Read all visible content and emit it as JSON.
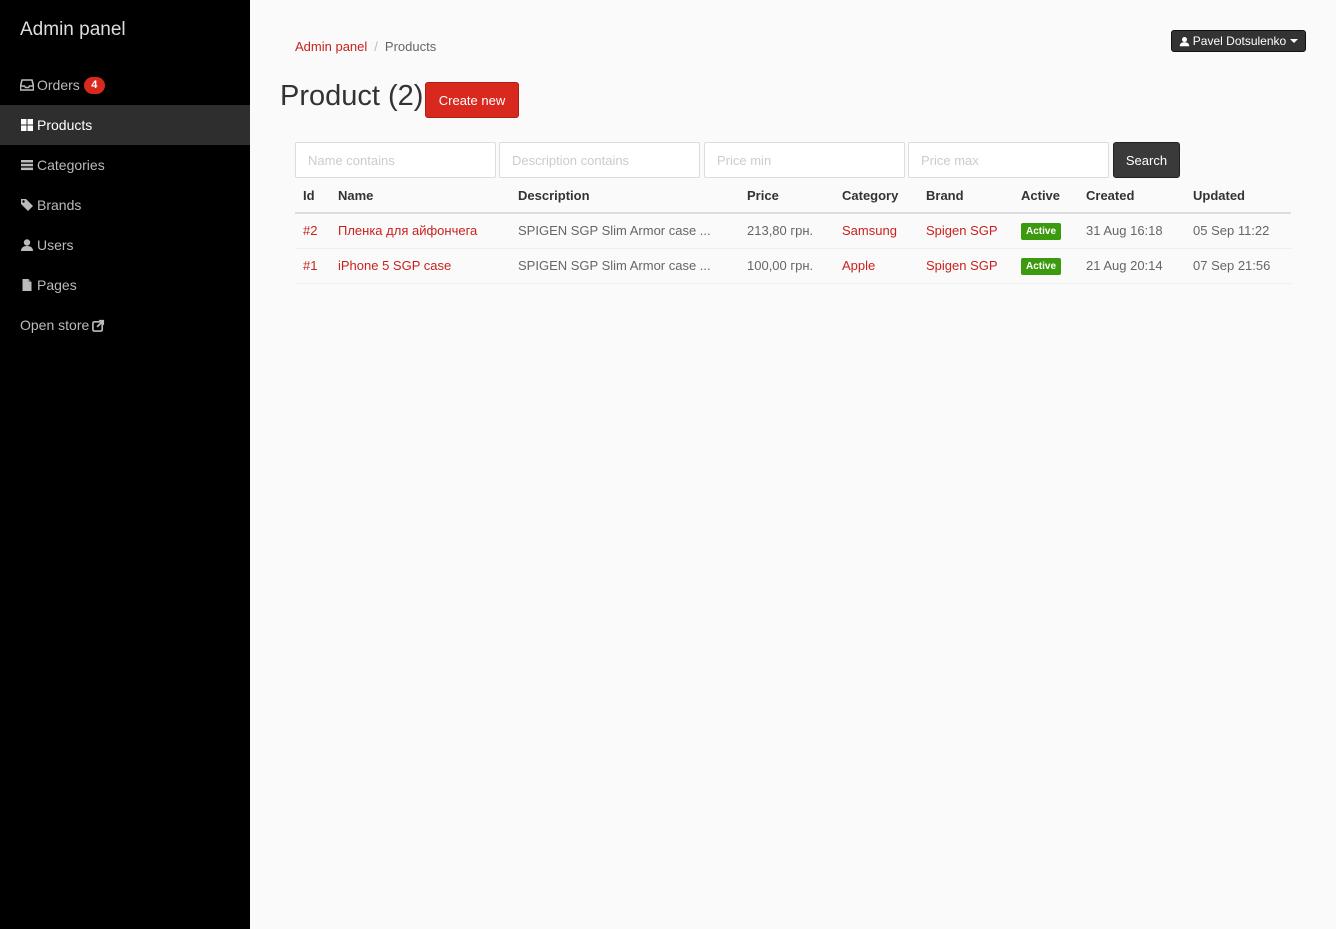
{
  "sidebar": {
    "brand": "Admin panel",
    "items": [
      {
        "label": "Orders",
        "icon": "inbox-icon",
        "badge": "4"
      },
      {
        "label": "Products",
        "icon": "grid-icon",
        "active": true
      },
      {
        "label": "Categories",
        "icon": "list-icon"
      },
      {
        "label": "Brands",
        "icon": "tags-icon"
      },
      {
        "label": "Users",
        "icon": "user-icon"
      },
      {
        "label": "Pages",
        "icon": "file-icon"
      },
      {
        "label": "Open store",
        "icon": "external-link-icon"
      }
    ]
  },
  "header": {
    "user_name": "Pavel Dotsulenko",
    "breadcrumb": {
      "root": "Admin panel",
      "current": "Products"
    }
  },
  "main": {
    "title": "Product (2)",
    "create_label": "Create new",
    "filters": {
      "name_placeholder": "Name contains",
      "description_placeholder": "Description contains",
      "price_min_placeholder": "Price min",
      "price_max_placeholder": "Price max",
      "search_label": "Search"
    },
    "table": {
      "columns": [
        "Id",
        "Name",
        "Description",
        "Price",
        "Category",
        "Brand",
        "Active",
        "Created",
        "Updated"
      ],
      "rows": [
        {
          "id": "#2",
          "name": "Пленка для айфончега",
          "description": "SPIGEN SGP Slim Armor case ...",
          "price": "213,80 грн.",
          "category": "Samsung",
          "brand": "Spigen SGP",
          "active": "Active",
          "created": "31 Aug 16:18",
          "updated": "05 Sep 11:22"
        },
        {
          "id": "#1",
          "name": "iPhone 5 SGP case",
          "description": "SPIGEN SGP Slim Armor case ...",
          "price": "100,00 грн.",
          "category": "Apple",
          "brand": "Spigen SGP",
          "active": "Active",
          "created": "21 Aug 20:14",
          "updated": "07 Sep 21:56"
        }
      ]
    }
  },
  "colors": {
    "accent": "#d9281e",
    "link": "#c9211e",
    "sidebar_bg": "#000000",
    "active_badge": "#3c9a0f"
  }
}
